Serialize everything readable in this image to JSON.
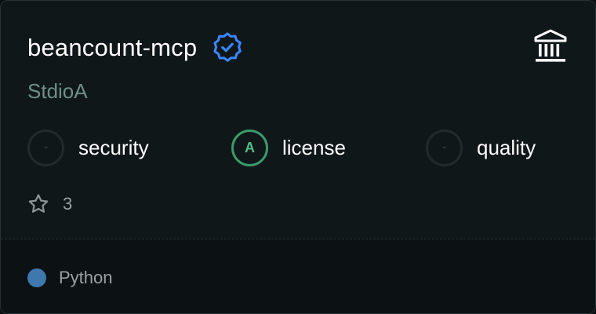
{
  "server": {
    "name": "beancount-mcp",
    "transport": "StdioA",
    "verified_icon": "verified-badge-icon",
    "type_icon": "bank-building-icon"
  },
  "scores": [
    {
      "grade": "-",
      "label": "security",
      "status": "none"
    },
    {
      "grade": "A",
      "label": "license",
      "status": "good"
    },
    {
      "grade": "-",
      "label": "quality",
      "status": "none"
    }
  ],
  "stars": {
    "icon": "star-outline-icon",
    "count": "3"
  },
  "language": {
    "name": "Python",
    "color": "#3f78ad"
  },
  "colors": {
    "card_background": "#101719",
    "footer_background": "#0c1113",
    "accent_blue": "#3a86ff",
    "grade_good": "#4fbf86",
    "subtitle": "#6e8f86"
  }
}
